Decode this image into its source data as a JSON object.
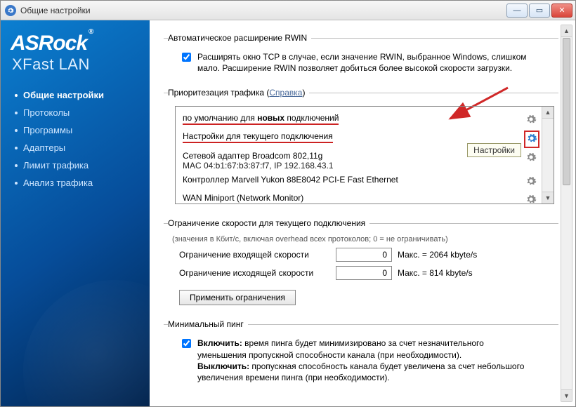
{
  "window": {
    "title": "Общие настройки"
  },
  "brand": {
    "logo": "ASRock",
    "product": "XFast LAN"
  },
  "sidebar": {
    "items": [
      {
        "label": "Общие настройки",
        "active": true
      },
      {
        "label": "Протоколы"
      },
      {
        "label": "Программы"
      },
      {
        "label": "Адаптеры"
      },
      {
        "label": "Лимит трафика"
      },
      {
        "label": "Анализ трафика"
      }
    ]
  },
  "rwin": {
    "legend": "Автоматическое расширение RWIN",
    "checkbox_label": "Расширять окно TCP в случае, если значение RWIN, выбранное Windows, слишком мало. Расширение RWIN позволяет добиться более высокой скорости загрузки.",
    "checked": true
  },
  "priority": {
    "legend_prefix": "Приоритезация трафика (",
    "legend_link": "Справка",
    "legend_suffix": ")",
    "rows": [
      {
        "label_html": "по умолчанию для <b>новых</b> подключений",
        "highlight": false
      },
      {
        "label_html": "Настройки для текущего подключения",
        "highlight": true,
        "gear_blue": true,
        "gear_boxed": true
      },
      {
        "label_html": "Сетевой адаптер Broadcom 802,11g",
        "sub": "MAC 04:b1:67:b3:87:f7, IP 192.168.43.1"
      },
      {
        "label_html": "Контроллер Marvell Yukon 88E8042 PCI-E Fast Ethernet"
      },
      {
        "label_html": "WAN Miniport (Network Monitor)"
      }
    ],
    "tooltip": "Настройки"
  },
  "speed": {
    "legend": "Ограничение скорости для текущего подключения",
    "sublabel": "(значения в Кбит/с, включая overhead всех протоколов; 0 = не ограничивать)",
    "in_label": "Ограничение входящей скорости",
    "in_value": "0",
    "in_max": "Макс. = 2064 kbyte/s",
    "out_label": "Ограничение исходящей скорости",
    "out_value": "0",
    "out_max": "Макс. = 814 kbyte/s",
    "apply": "Применить ограничения"
  },
  "ping": {
    "legend": "Минимальный пинг",
    "checked": true,
    "text_html": "<b>Включить:</b> время пинга будет минимизировано за счет незначительного уменьшения пропускной способности канала (при необходимости).<br><b>Выключить:</b> пропускная способность канала будет увеличена за счет небольшого увеличения времени пинга (при необходимости)."
  }
}
